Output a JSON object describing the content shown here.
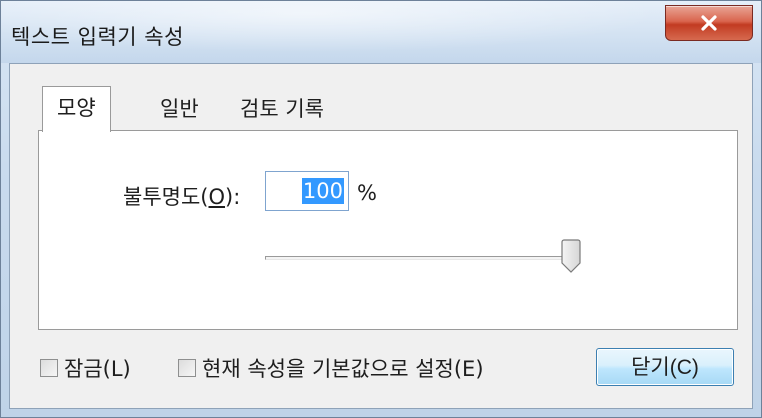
{
  "window": {
    "title": "텍스트 입력기 속성",
    "close_icon": "close-x-icon"
  },
  "tabs": [
    {
      "label": "모양",
      "active": true
    },
    {
      "label": "일반",
      "active": false
    },
    {
      "label": "검토 기록",
      "active": false
    }
  ],
  "appearance": {
    "opacity_label_prefix": "불투명도(",
    "opacity_label_mnemonic": "O",
    "opacity_label_suffix": "):",
    "opacity_value": "100",
    "opacity_unit": "%",
    "slider_level_percent": 100
  },
  "footer": {
    "lock_label": "잠금(L)",
    "lock_checked": false,
    "default_label": "현재 속성을 기본값으로 설정(E)",
    "default_checked": false,
    "close_button_label": "닫기(C)"
  },
  "colors": {
    "selection": "#3399ff",
    "close_button": "#c23b22"
  }
}
